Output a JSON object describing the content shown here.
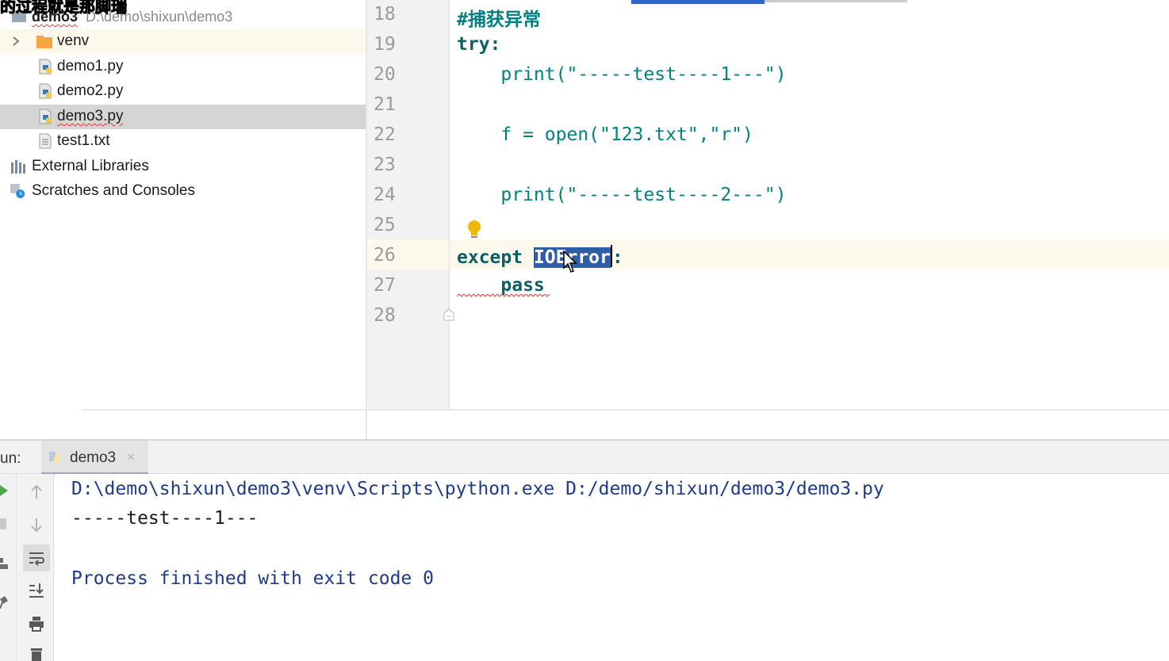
{
  "overlay_caption": "的过程就是那脚瑞",
  "project_tree": {
    "root": {
      "label": "demo3",
      "path": "D:\\demo\\shixun\\demo3"
    },
    "items": [
      {
        "label": "venv",
        "icon": "folder-icon"
      },
      {
        "label": "demo1.py",
        "icon": "python-file-icon"
      },
      {
        "label": "demo2.py",
        "icon": "python-file-icon"
      },
      {
        "label": "demo3.py",
        "icon": "python-file-icon"
      },
      {
        "label": "test1.txt",
        "icon": "text-file-icon"
      },
      {
        "label": "External Libraries",
        "icon": "library-icon"
      },
      {
        "label": "Scratches and Consoles",
        "icon": "scratches-icon"
      }
    ]
  },
  "editor": {
    "line_numbers": [
      "18",
      "19",
      "20",
      "21",
      "22",
      "23",
      "24",
      "25",
      "26",
      "27",
      "28"
    ],
    "lines": {
      "l18": "#捕获异常",
      "l19": "try:",
      "l20": "    print(\"-----test----1---\")",
      "l22": "    f = open(\"123.txt\",\"r\")",
      "l24": "    print(\"-----test----2---\")",
      "l26_keyword": "except ",
      "l26_selected": "IOError",
      "l26_rest": ":",
      "l27": "    pass"
    }
  },
  "run_panel": {
    "label": "un:",
    "tab_label": "demo3",
    "tab_close": "×",
    "console": {
      "command": "D:\\demo\\shixun\\demo3\\venv\\Scripts\\python.exe D:/demo/shixun/demo3/demo3.py",
      "output_1": "-----test----1---",
      "exit_message": "Process finished with exit code 0"
    }
  },
  "colors": {
    "selection": "#2f5ea8",
    "code_teal": "#008080",
    "console_command": "#1e3a8a",
    "squiggle": "#e53935"
  }
}
